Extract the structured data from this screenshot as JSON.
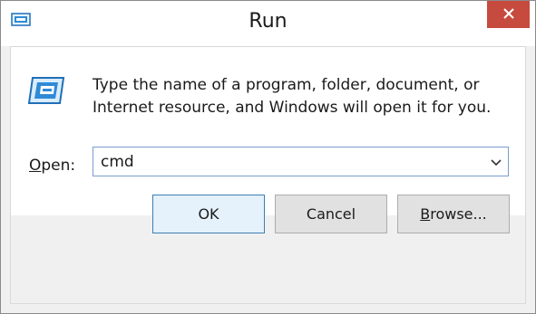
{
  "window": {
    "title": "Run",
    "close_icon": "close-icon",
    "title_icon": "run-icon"
  },
  "content": {
    "description_line1": "Type the name of a program, folder, document, or",
    "description_line2": "Internet resource, and Windows will open it for you.",
    "open_label_mnemonic": "O",
    "open_label_rest": "pen:",
    "combo_value": "cmd",
    "combo_arrow_icon": "chevron-down-icon"
  },
  "buttons": {
    "ok": "OK",
    "cancel": "Cancel",
    "browse_mnemonic": "B",
    "browse_rest": "rowse..."
  },
  "colors": {
    "close_button": "#c74a3f",
    "input_border": "#7a9ccf",
    "default_button_border": "#3c7fb1"
  }
}
